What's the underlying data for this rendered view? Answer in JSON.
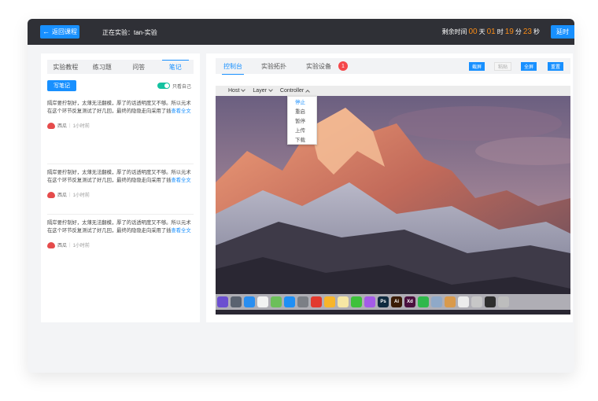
{
  "header": {
    "back_label": "返回课程",
    "experiment_title": "正在实验：tan-实验",
    "timer": {
      "prefix": "剩余时间",
      "days": "00",
      "days_unit": "天",
      "hours": "01",
      "hours_unit": "时",
      "minutes": "19",
      "minutes_unit": "分",
      "seconds": "23",
      "seconds_unit": "秒"
    },
    "extend_label": "延时"
  },
  "left": {
    "tabs": [
      {
        "label": "实验教程"
      },
      {
        "label": "练习题"
      },
      {
        "label": "问答"
      },
      {
        "label": "笔记"
      }
    ],
    "write_label": "写笔记",
    "toggle_label": "只看自己",
    "notes": [
      {
        "text": "隔岸要拧制好，太薄无法翻模，厚了的话透明度又不够。所以元术在这个环节反复测试了好几回，最终的隐隐走向采用了插",
        "more": "查看全文",
        "author": "西瓜",
        "time": "1小时前"
      },
      {
        "text": "隔岸要拧制好，太薄无法翻模，厚了的话透明度又不够。所以元术在这个环节反复测试了好几回，最终的隐隐走向采用了插",
        "more": "查看全文",
        "author": "西瓜",
        "time": "1小时前"
      },
      {
        "text": "隔岸要拧制好，太薄无法翻模，厚了的话透明度又不够。所以元术在这个环节反复测试了好几回，最终的隐隐走向采用了插",
        "more": "查看全文",
        "author": "西瓜",
        "time": "1小时前"
      }
    ]
  },
  "right": {
    "tabs": [
      {
        "label": "控制台"
      },
      {
        "label": "实验拓扑"
      },
      {
        "label": "实验设备"
      }
    ],
    "badge": "1",
    "actions": {
      "screenshot": "截屏",
      "paste": "粘贴",
      "fullscreen": "全屏",
      "reset": "重置"
    },
    "menubar": [
      {
        "label": "Host"
      },
      {
        "label": "Layer"
      },
      {
        "label": "Controller"
      }
    ],
    "dropdown": [
      {
        "label": "停止"
      },
      {
        "label": "重启"
      },
      {
        "label": "暂停"
      },
      {
        "label": "上传"
      },
      {
        "label": "下载"
      }
    ],
    "dock_apps": [
      {
        "name": "siri-icon",
        "color": "#6b4fd0"
      },
      {
        "name": "launchpad-icon",
        "color": "#5a6270"
      },
      {
        "name": "safari-icon",
        "color": "#2a8ef0"
      },
      {
        "name": "calendar-icon",
        "color": "#f2f2f2"
      },
      {
        "name": "maps-icon",
        "color": "#6cbf5a"
      },
      {
        "name": "app-store-icon",
        "color": "#1f8ff5"
      },
      {
        "name": "system-preferences-icon",
        "color": "#7b7f86"
      },
      {
        "name": "netease-music-icon",
        "color": "#e23a2e"
      },
      {
        "name": "sketch-icon",
        "color": "#f7b52a"
      },
      {
        "name": "notes-icon",
        "color": "#f6e7a4"
      },
      {
        "name": "wechat-icon",
        "color": "#3ec13b"
      },
      {
        "name": "picsart-icon",
        "color": "#a45be8"
      },
      {
        "name": "photoshop-icon",
        "label": "Ps",
        "color": "#0f2a3f"
      },
      {
        "name": "illustrator-icon",
        "label": "Ai",
        "color": "#3a1c05"
      },
      {
        "name": "xd-icon",
        "label": "Xd",
        "color": "#4a103d"
      },
      {
        "name": "facetime-icon",
        "color": "#2fb84b"
      },
      {
        "name": "preview-icon",
        "color": "#8fa9c8"
      },
      {
        "name": "finder-icon",
        "color": "#d99a4c"
      },
      {
        "name": "document-icon",
        "color": "#ececec"
      },
      {
        "name": "keyboard-icon",
        "color": "#c7c7c7"
      },
      {
        "name": "terminal-icon",
        "color": "#2e2e2e"
      },
      {
        "name": "console-icon",
        "color": "#bdbdbd"
      }
    ]
  }
}
